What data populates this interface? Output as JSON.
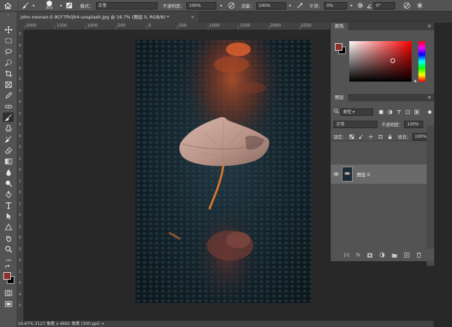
{
  "options_bar": {
    "brush_size": "859",
    "mode_label": "模式：",
    "mode_value": "正常",
    "opacity_label": "不透明度：",
    "opacity_value": "100%",
    "flow_label": "流量：",
    "flow_value": "100%",
    "smoothing_label": "平滑：",
    "smoothing_value": "0%",
    "angle_value": "0°"
  },
  "document_tab": {
    "title": "john-noonan-E-9CF7fhQh4-unsplash.jpg @ 16.7% (图层 0, RGB/8) *",
    "close": "×"
  },
  "ruler": {
    "h_labels": [
      "2000",
      "1500",
      "1000",
      "500",
      "0",
      "500",
      "1000",
      "1500",
      "2000",
      "2500",
      "3000"
    ],
    "v_labels": [
      "2",
      "0",
      "5",
      "0",
      "0",
      "5",
      "0",
      "5",
      "0",
      "0",
      "5",
      "1",
      "0",
      "1",
      "5",
      "2",
      "0",
      "2",
      "5",
      "3",
      "0",
      "3",
      "5",
      "4",
      "0"
    ]
  },
  "status_bar": {
    "text": "16.67%    3127 像素 x 4691 像素 (300 ppi)    >"
  },
  "color_panel": {
    "title": "颜色",
    "menu": "≡",
    "foreground_color": "#8f2f2c",
    "background_color": "#000000",
    "hue_base": "#ff0000"
  },
  "layers_panel": {
    "title": "图层",
    "menu": "≡",
    "filter_kind": "类型",
    "blend_mode": "正常",
    "opacity_label": "不透明度：",
    "opacity_value": "100%",
    "lock_label": "锁定：",
    "fill_label": "填充：",
    "fill_value": "100%",
    "layers": [
      {
        "name": "图层 0",
        "visible": true
      }
    ],
    "footer_icons": [
      "link-icon",
      "fx-icon",
      "mask-icon",
      "adjustment-icon",
      "folder-icon",
      "new-layer-icon",
      "trash-icon"
    ],
    "fx_label": "fx"
  },
  "colors": {
    "ui_dark": "#282828",
    "ui_mid": "#535353",
    "ui_panel_head": "#3d3d3d",
    "layer_selected": "#6a6a6a",
    "leaf": "#c9a59a",
    "stem": "#d9782e",
    "highlight_orange": "#c9542e"
  }
}
